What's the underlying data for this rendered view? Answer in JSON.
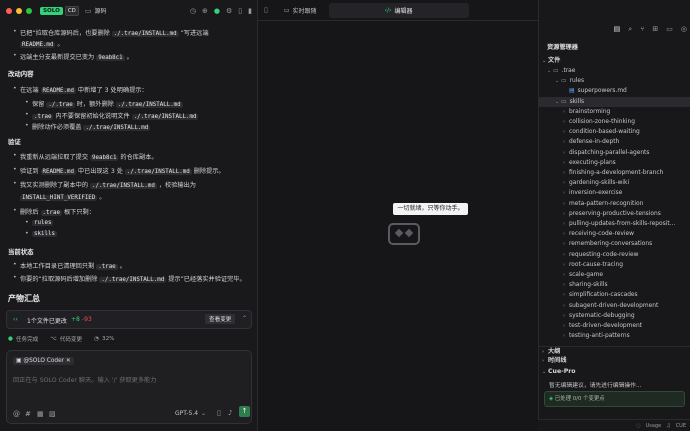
{
  "topbar": {
    "solo_badge": "SOLO",
    "solo_badge2": "CD",
    "source_label": "源码"
  },
  "chat": {
    "lines": [
      {
        "kind": "bullet",
        "parts": [
          [
            "t",
            "已把"
          ],
          [
            "t",
            "“拉取仓库源码后，也要删除 "
          ],
          [
            "c",
            "./.trae/INSTALL.md"
          ],
          [
            "t",
            " ”写进远端"
          ]
        ]
      },
      {
        "kind": "cont",
        "parts": [
          [
            "c",
            "README.md"
          ],
          [
            "t",
            " 。"
          ]
        ]
      },
      {
        "kind": "bullet",
        "parts": [
          [
            "t",
            "远端主分支最新提交已变为 "
          ],
          [
            "c",
            "9eab8c1"
          ],
          [
            "t",
            " 。"
          ]
        ]
      },
      {
        "kind": "head",
        "parts": [
          [
            "t",
            "改动内容"
          ]
        ]
      },
      {
        "kind": "bullet",
        "parts": [
          [
            "t",
            "在远端 "
          ],
          [
            "c",
            "README.md"
          ],
          [
            "t",
            " 中新增了 3 处明确提示："
          ]
        ]
      },
      {
        "kind": "sub",
        "parts": [
          [
            "t",
            "保留 "
          ],
          [
            "c",
            "./.trae"
          ],
          [
            "t",
            " 时，额外删除 "
          ],
          [
            "c",
            "./.trae/INSTALL.md"
          ]
        ]
      },
      {
        "kind": "sub",
        "parts": [
          [
            "c",
            ".trae"
          ],
          [
            "t",
            " 内不要保留初始化说明文件 "
          ],
          [
            "c",
            "./.trae/INSTALL.md"
          ]
        ]
      },
      {
        "kind": "sub",
        "parts": [
          [
            "t",
            "删除动作必须覆盖 "
          ],
          [
            "c",
            "./.trae/INSTALL.md"
          ]
        ]
      },
      {
        "kind": "head",
        "parts": [
          [
            "t",
            "验证"
          ]
        ]
      },
      {
        "kind": "bullet",
        "parts": [
          [
            "t",
            "我重新从远端拉取了提交 "
          ],
          [
            "c",
            "9eab8c1"
          ],
          [
            "t",
            " 的仓库副本。"
          ]
        ]
      },
      {
        "kind": "bullet",
        "parts": [
          [
            "t",
            "验证到 "
          ],
          [
            "c",
            "README.md"
          ],
          [
            "t",
            " 中已出现这 3 处 "
          ],
          [
            "c",
            "./.trae/INSTALL.md"
          ],
          [
            "t",
            " 删除提示。"
          ]
        ]
      },
      {
        "kind": "bullet",
        "parts": [
          [
            "t",
            "我又实测删除了副本中的 "
          ],
          [
            "c",
            "./.trae/INSTALL.md"
          ],
          [
            "t",
            " ，校验输出为"
          ]
        ]
      },
      {
        "kind": "cont",
        "parts": [
          [
            "c",
            "INSTALL_HINT_VERIFIED"
          ],
          [
            "t",
            " 。"
          ]
        ]
      },
      {
        "kind": "bullet",
        "parts": [
          [
            "t",
            "删除后 "
          ],
          [
            "c",
            ".trae"
          ],
          [
            "t",
            " 根下只剩："
          ]
        ]
      },
      {
        "kind": "sub",
        "parts": [
          [
            "c",
            "rules"
          ]
        ]
      },
      {
        "kind": "sub",
        "parts": [
          [
            "c",
            "skills"
          ]
        ]
      },
      {
        "kind": "head",
        "parts": [
          [
            "t",
            "当前状态"
          ]
        ]
      },
      {
        "kind": "bullet",
        "parts": [
          [
            "t",
            "本地工作目录已清理回只剩 "
          ],
          [
            "c",
            ".trae"
          ],
          [
            "t",
            " 。"
          ]
        ]
      },
      {
        "kind": "bullet",
        "parts": [
          [
            "t",
            "你要的“拉取源码后增加删除 "
          ],
          [
            "c",
            "./.trae/INSTALL.md"
          ],
          [
            "t",
            " 提示”已经落实并验证完毕。"
          ]
        ]
      }
    ],
    "summary_title": "产物汇总"
  },
  "changes": {
    "label": "1个文件已更改",
    "added": "+8",
    "removed": "-93",
    "review_button": "查看变更"
  },
  "task_status": {
    "done": "任务完成",
    "code_changes": "代码变更",
    "percent": "32%"
  },
  "input": {
    "agent": "@SOLO Coder",
    "placeholder": "回正在与 SOLO Coder 聊天。输入 '/' 获取更多能力",
    "model": "GPT-5.4"
  },
  "middle": {
    "tab1": "实时跟随",
    "tab2": "编辑器",
    "tooltip": "一切就绪，只等你动手。"
  },
  "explorer": {
    "title": "资源管理器",
    "section_files": "文件",
    "tree": [
      {
        "label": ".trae",
        "depth": 0,
        "type": "folder-open"
      },
      {
        "label": "rules",
        "depth": 1,
        "type": "folder-open"
      },
      {
        "label": "superpowers.md",
        "depth": 2,
        "type": "file"
      },
      {
        "label": "skills",
        "depth": 1,
        "type": "folder-open",
        "selected": true
      },
      {
        "label": "brainstorming",
        "depth": 2,
        "type": "folder"
      },
      {
        "label": "collision-zone-thinking",
        "depth": 2,
        "type": "folder"
      },
      {
        "label": "condition-based-waiting",
        "depth": 2,
        "type": "folder"
      },
      {
        "label": "defense-in-depth",
        "depth": 2,
        "type": "folder"
      },
      {
        "label": "dispatching-parallel-agents",
        "depth": 2,
        "type": "folder"
      },
      {
        "label": "executing-plans",
        "depth": 2,
        "type": "folder"
      },
      {
        "label": "finishing-a-development-branch",
        "depth": 2,
        "type": "folder"
      },
      {
        "label": "gardening-skills-wiki",
        "depth": 2,
        "type": "folder"
      },
      {
        "label": "inversion-exercise",
        "depth": 2,
        "type": "folder"
      },
      {
        "label": "meta-pattern-recognition",
        "depth": 2,
        "type": "folder"
      },
      {
        "label": "preserving-productive-tensions",
        "depth": 2,
        "type": "folder"
      },
      {
        "label": "pulling-updates-from-skills-reposit...",
        "depth": 2,
        "type": "folder"
      },
      {
        "label": "receiving-code-review",
        "depth": 2,
        "type": "folder"
      },
      {
        "label": "remembering-conversations",
        "depth": 2,
        "type": "folder"
      },
      {
        "label": "requesting-code-review",
        "depth": 2,
        "type": "folder"
      },
      {
        "label": "root-cause-tracing",
        "depth": 2,
        "type": "folder"
      },
      {
        "label": "scale-game",
        "depth": 2,
        "type": "folder"
      },
      {
        "label": "sharing-skills",
        "depth": 2,
        "type": "folder"
      },
      {
        "label": "simplification-cascades",
        "depth": 2,
        "type": "folder"
      },
      {
        "label": "subagent-driven-development",
        "depth": 2,
        "type": "folder"
      },
      {
        "label": "systematic-debugging",
        "depth": 2,
        "type": "folder"
      },
      {
        "label": "test-driven-development",
        "depth": 2,
        "type": "folder"
      },
      {
        "label": "testing-anti-patterns",
        "depth": 2,
        "type": "folder"
      }
    ],
    "section_outline": "大纲",
    "section_timeline": "时间线",
    "cue_title": "Cue-Pro",
    "cue_desc": "暂无编辑建议，请先进行编辑操作...",
    "cue_status": "已处理 0/0 个变更点"
  },
  "statusbar": {
    "usage": "Usage",
    "cue": "CUE"
  }
}
